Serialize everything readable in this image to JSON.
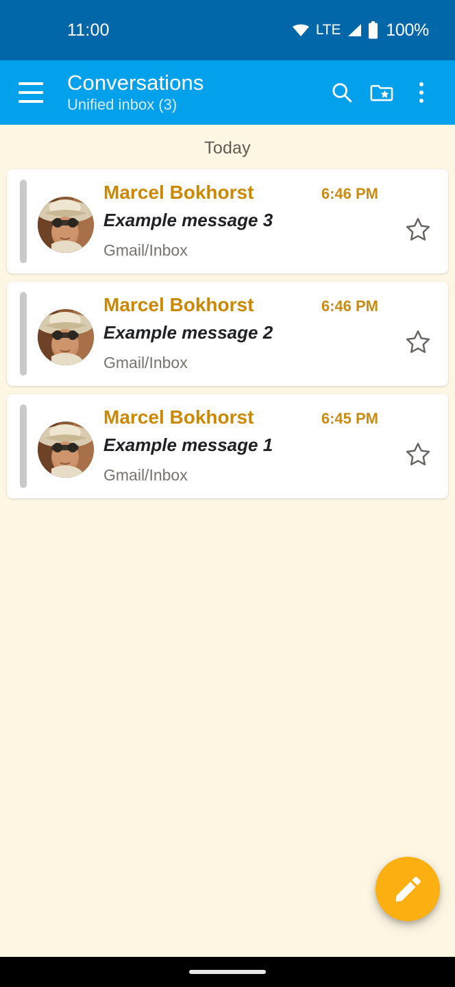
{
  "status_bar": {
    "clock": "11:00",
    "network_type": "LTE",
    "battery_percent": "100%",
    "icons": [
      "wifi-icon",
      "signal-icon",
      "battery-icon"
    ],
    "background_color": "#0167A8"
  },
  "toolbar": {
    "menu_icon": "hamburger-menu-icon",
    "title": "Conversations",
    "subtitle": "Unified inbox (3)",
    "background_color": "#03A0EC",
    "actions": [
      {
        "name": "search",
        "icon": "search-icon",
        "label": "Search"
      },
      {
        "name": "folders",
        "icon": "folder-star-icon",
        "label": "Folders"
      },
      {
        "name": "overflow",
        "icon": "more-vertical-icon",
        "label": "More options"
      }
    ]
  },
  "list": {
    "date_header": "Today",
    "background_color": "#FDF6E3",
    "accent_color": "#CB8800",
    "messages": [
      {
        "sender": "Marcel Bokhorst",
        "time": "6:46 PM",
        "subject": "Example message 3",
        "folder": "Gmail/Inbox",
        "starred": false,
        "avatar": "contact-photo"
      },
      {
        "sender": "Marcel Bokhorst",
        "time": "6:46 PM",
        "subject": "Example message 2",
        "folder": "Gmail/Inbox",
        "starred": false,
        "avatar": "contact-photo"
      },
      {
        "sender": "Marcel Bokhorst",
        "time": "6:45 PM",
        "subject": "Example message 1",
        "folder": "Gmail/Inbox",
        "starred": false,
        "avatar": "contact-photo"
      }
    ]
  },
  "fab": {
    "icon": "compose-pencil-icon",
    "label": "Compose",
    "color": "#FBAF11"
  },
  "nav_bar": {
    "handle": "gesture-handle",
    "background_color": "#000000"
  }
}
